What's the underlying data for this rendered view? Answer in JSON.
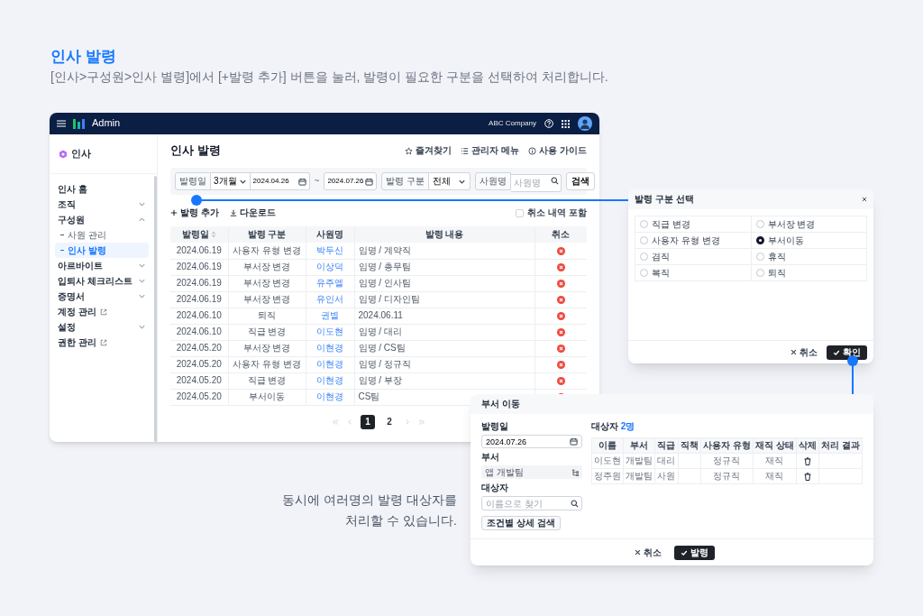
{
  "guide": {
    "title": "인사 발령",
    "description": "[인사>구성원>인사 별령]에서 [+발령 추가] 버튼을 눌러, 발령이 필요한 구분을 선택하여 처리합니다."
  },
  "main_window": {
    "header": {
      "brand": "Admin",
      "company": "ABC Company"
    },
    "sidebar": {
      "section": "인사",
      "items": [
        {
          "label": "인사 홈",
          "kind": "link",
          "selected": false
        },
        {
          "label": "조직",
          "kind": "group",
          "expanded": false,
          "selected": false
        },
        {
          "label": "구성원",
          "kind": "group",
          "expanded": true,
          "selected": false,
          "children": [
            {
              "label": "사원 관리",
              "selected": false
            },
            {
              "label": "인사 발령",
              "selected": true
            }
          ]
        },
        {
          "label": "아르바이트",
          "kind": "group",
          "expanded": false,
          "selected": false
        },
        {
          "label": "입퇴사 체크리스트",
          "kind": "group",
          "expanded": false,
          "selected": false
        },
        {
          "label": "증명서",
          "kind": "group",
          "expanded": false,
          "selected": false
        },
        {
          "label": "계정 관리",
          "kind": "external",
          "selected": false
        },
        {
          "label": "설정",
          "kind": "group",
          "expanded": false,
          "selected": false
        },
        {
          "label": "권한 관리",
          "kind": "external",
          "selected": false
        }
      ]
    },
    "page": {
      "title": "인사 발령",
      "links": [
        "즐겨찾기",
        "관리자 메뉴",
        "사용 가이드"
      ],
      "filter": {
        "date_label": "발령일",
        "period": "3개월",
        "start_date": "2024.04.26",
        "separator": "~",
        "end_date": "2024.07.26",
        "type_label": "발령 구분",
        "type_value": "전체",
        "name_label": "사원명",
        "name_placeholder": "사원명",
        "search_button": "검색"
      },
      "actions": [
        "발령 추가",
        "다운로드"
      ],
      "include_cancelled": {
        "label": "취소 내역 포함",
        "checked": false
      },
      "table": {
        "columns": [
          "발령일",
          "발령 구분",
          "사원명",
          "발령 내용",
          "취소"
        ],
        "rows": [
          {
            "date": "2024.06.19",
            "type": "사용자 유형 변경",
            "employee": "박두신",
            "content": "임명 / 계약직"
          },
          {
            "date": "2024.06.19",
            "type": "부서장 변경",
            "employee": "이상덕",
            "content": "임명 / 총무팀"
          },
          {
            "date": "2024.06.19",
            "type": "부서장 변경",
            "employee": "유주엘",
            "content": "임명 / 인사팀"
          },
          {
            "date": "2024.06.19",
            "type": "부서장 변경",
            "employee": "유인서",
            "content": "임명 / 디자인팀"
          },
          {
            "date": "2024.06.10",
            "type": "퇴직",
            "employee": "권별",
            "content": "2024.06.11"
          },
          {
            "date": "2024.06.10",
            "type": "직급 변경",
            "employee": "이도현",
            "content": "임명 / 대리"
          },
          {
            "date": "2024.05.20",
            "type": "부서장 변경",
            "employee": "이현경",
            "content": "임명 / CS팀"
          },
          {
            "date": "2024.05.20",
            "type": "사용자 유형 변경",
            "employee": "이현경",
            "content": "임명 / 정규직"
          },
          {
            "date": "2024.05.20",
            "type": "직급 변경",
            "employee": "이현경",
            "content": "임명 / 부장"
          },
          {
            "date": "2024.05.20",
            "type": "부서이동",
            "employee": "이현경",
            "content": "CS팀"
          }
        ]
      },
      "pagination": [
        {
          "label": "1",
          "selected": true
        },
        {
          "label": "2",
          "selected": false
        }
      ]
    }
  },
  "type_dialog": {
    "title": "발령 구분 선택",
    "options": [
      {
        "label": "직급 변경",
        "selected": false
      },
      {
        "label": "부서장 변경",
        "selected": false
      },
      {
        "label": "사용자 유형 변경",
        "selected": false
      },
      {
        "label": "부서이동",
        "selected": true
      },
      {
        "label": "겸직",
        "selected": false
      },
      {
        "label": "휴직",
        "selected": false
      },
      {
        "label": "복직",
        "selected": false
      },
      {
        "label": "퇴직",
        "selected": false
      }
    ],
    "buttons": [
      {
        "label": "취소",
        "kind": "cancel"
      },
      {
        "label": "확인",
        "kind": "confirm"
      }
    ]
  },
  "move_dialog": {
    "title": "부서 이동",
    "date_label": "발령일",
    "date_value": "2024.07.26",
    "department_label": "부서",
    "department_value": "앱 개발팀",
    "target_label": "대상자",
    "target_placeholder": "이름으로 찾기",
    "detail_search_button": "조건별 상세 검색",
    "targets_title": "대상자",
    "targets_count": "2명",
    "table": {
      "columns": [
        "이름",
        "부서",
        "직급",
        "직책",
        "사용자 유형",
        "재직 상태",
        "삭제",
        "처리 결과"
      ],
      "rows": [
        {
          "name": "이도현",
          "department": "개발팀",
          "rank": "대리",
          "user_type": "정규직",
          "status": "재직"
        },
        {
          "name": "정주원",
          "department": "개발팀",
          "rank": "사원",
          "user_type": "정규직",
          "status": "재직"
        }
      ]
    },
    "buttons": [
      {
        "label": "취소",
        "kind": "cancel"
      },
      {
        "label": "발령",
        "kind": "confirm"
      }
    ]
  },
  "caption": [
    "동시에 여러명의 발령 대상자를",
    "처리할 수 있습니다."
  ]
}
